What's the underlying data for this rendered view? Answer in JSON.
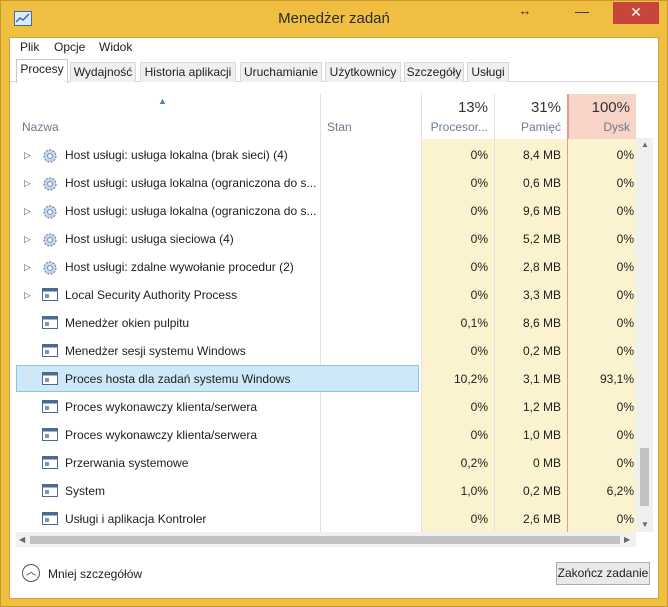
{
  "window": {
    "title": "Menedżer zadań",
    "restore_glyph": "↔",
    "minimize_glyph": "—",
    "close_glyph": "✕"
  },
  "menu": [
    "Plik",
    "Opcje",
    "Widok"
  ],
  "tabs": [
    "Procesy",
    "Wydajność",
    "Historia aplikacji",
    "Uruchamianie",
    "Użytkownicy",
    "Szczegóły",
    "Usługi"
  ],
  "active_tab": "Procesy",
  "columns": {
    "name": "Nazwa",
    "status": "Stan",
    "cpu": {
      "label": "Procesor...",
      "percent": "13%"
    },
    "memory": {
      "label": "Pamięć",
      "percent": "31%"
    },
    "disk": {
      "label": "Dysk",
      "percent": "100%"
    }
  },
  "rows": [
    {
      "name": "Host usługi: usługa lokalna (brak sieci) (4)",
      "cpu": "0%",
      "memory": "8,4 MB",
      "disk": "0%",
      "icon": "gear-icon",
      "expandable": true
    },
    {
      "name": "Host usługi: usługa lokalna (ograniczona do s...",
      "cpu": "0%",
      "memory": "0,6 MB",
      "disk": "0%",
      "icon": "gear-icon",
      "expandable": true
    },
    {
      "name": "Host usługi: usługa lokalna (ograniczona do s...",
      "cpu": "0%",
      "memory": "9,6 MB",
      "disk": "0%",
      "icon": "gear-icon",
      "expandable": true
    },
    {
      "name": "Host usługi: usługa sieciowa (4)",
      "cpu": "0%",
      "memory": "5,2 MB",
      "disk": "0%",
      "icon": "gear-icon",
      "expandable": true
    },
    {
      "name": "Host usługi: zdalne wywołanie procedur (2)",
      "cpu": "0%",
      "memory": "2,8 MB",
      "disk": "0%",
      "icon": "gear-icon",
      "expandable": true
    },
    {
      "name": "Local Security Authority Process",
      "cpu": "0%",
      "memory": "3,3 MB",
      "disk": "0%",
      "icon": "window-icon",
      "expandable": true
    },
    {
      "name": "Menedżer okien pulpitu",
      "cpu": "0,1%",
      "memory": "8,6 MB",
      "disk": "0%",
      "icon": "window-icon",
      "expandable": false
    },
    {
      "name": "Menedżer sesji systemu Windows",
      "cpu": "0%",
      "memory": "0,2 MB",
      "disk": "0%",
      "icon": "window-icon",
      "expandable": false
    },
    {
      "name": "Proces hosta dla zadań systemu Windows",
      "cpu": "10,2%",
      "memory": "3,1 MB",
      "disk": "93,1%",
      "icon": "window-icon",
      "expandable": false,
      "selected": true
    },
    {
      "name": "Proces wykonawczy klienta/serwera",
      "cpu": "0%",
      "memory": "1,2 MB",
      "disk": "0%",
      "icon": "window-icon",
      "expandable": false
    },
    {
      "name": "Proces wykonawczy klienta/serwera",
      "cpu": "0%",
      "memory": "1,0 MB",
      "disk": "0%",
      "icon": "window-icon",
      "expandable": false
    },
    {
      "name": "Przerwania systemowe",
      "cpu": "0,2%",
      "memory": "0 MB",
      "disk": "0%",
      "icon": "window-icon",
      "expandable": false
    },
    {
      "name": "System",
      "cpu": "1,0%",
      "memory": "0,2 MB",
      "disk": "6,2%",
      "icon": "window-icon",
      "expandable": false
    },
    {
      "name": "Usługi i aplikacja Kontroler",
      "cpu": "0%",
      "memory": "2,6 MB",
      "disk": "0%",
      "icon": "window-icon",
      "expandable": false
    }
  ],
  "footer": {
    "fewer_details": "Mniej szczegółów",
    "end_task": "Zakończ zadanie"
  },
  "colors": {
    "frame": "#f0bf42",
    "close": "#c7463c",
    "cpu_col": "#fbf3d0",
    "mem_col": "#fbf3d0",
    "disk_col": "#fbf3d0",
    "disk_header": "#f8d3c8",
    "selected": "#cde8f7"
  }
}
